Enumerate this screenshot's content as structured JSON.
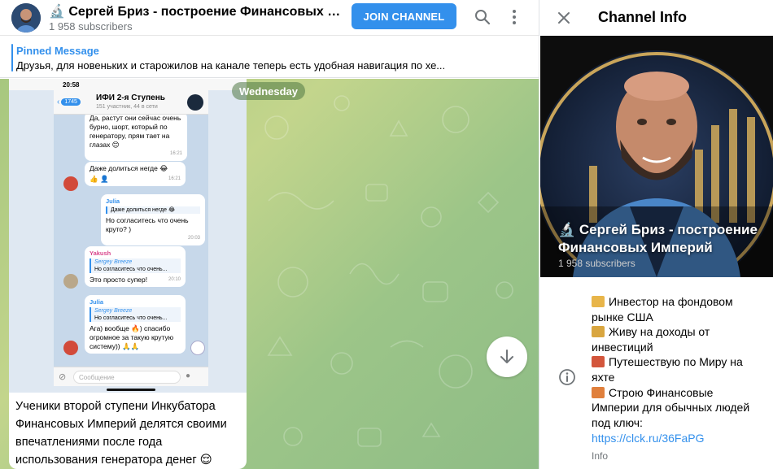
{
  "header": {
    "channel_title": "🔬 Сергей Бриз - построение Финансовых Имп...",
    "subscribers": "1 958 subscribers",
    "join_label": "JOIN CHANNEL"
  },
  "pinned": {
    "title": "Pinned Message",
    "text": "Друзья, для новеньких и старожилов на канале теперь есть удобная навигация по хе..."
  },
  "chat": {
    "date_label": "Wednesday",
    "caption": "Ученики второй ступени Инкубатора Финансовых Империй делятся своими впечатлениями после года использования генератора денег 😌",
    "phone": {
      "time": "20:58",
      "back_count": "1745",
      "title": "ИФИ 2-я Ступень",
      "subtitle": "151 участник, 44 в сети",
      "msg1": "Да, растут они сейчас очень бурно, шорт, который по генератору, прям тает на глазах 😊",
      "msg1_time": "16:21",
      "msg2": "Даже долиться негде 😂",
      "msg2_react": "👍 👤",
      "msg2_time": "16:21",
      "msg3_name": "Julia",
      "msg3_quote": "Даже долиться негде 😂",
      "msg3_text": "Но согласитесь что очень круто? )",
      "msg3_time": "20:03",
      "msg4_name": "Yakush",
      "msg4_quote_name": "Sergey Breeze",
      "msg4_quote": "Но согласитесь что очень...",
      "msg4_text": "Это просто супер!",
      "msg4_time": "20:10",
      "msg5_name": "Julia",
      "msg5_quote_name": "Sergey Breeze",
      "msg5_quote": "Но согласитесь что очень...",
      "msg5_text": "Ага) вообще 🔥) спасибо огромное за такую крутую систему)) 🙏🙏",
      "input_placeholder": "Сообщение"
    }
  },
  "info": {
    "title": "Channel Info",
    "name": "🔬 Сергей Бриз - построение Финансовых Империй",
    "subscribers": "1 958 subscribers",
    "about_lines": [
      "Инвестор на фондовом рынке США",
      "Живу на доходы от инвестиций",
      "Путешествую по Миру на яхте",
      "Строю Финансовые Империи для обычных людей под ключ:"
    ],
    "link": "https://clck.ru/36FaPG",
    "label": "Info"
  },
  "colors": {
    "accent": "#3390ec",
    "chat_bg": "#a7c77f",
    "muted": "#707579"
  }
}
